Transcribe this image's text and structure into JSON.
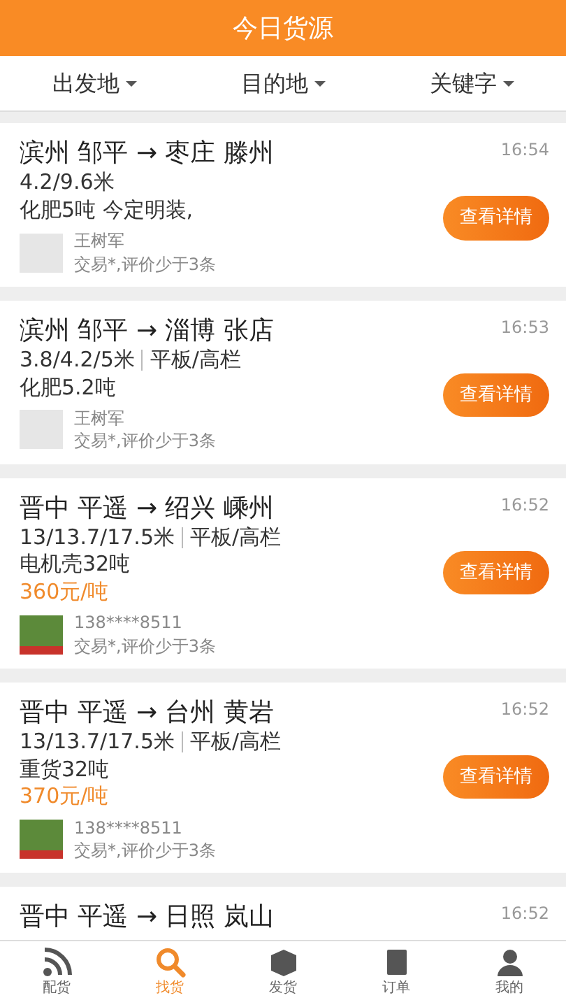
{
  "header": {
    "title": "今日货源"
  },
  "filters": [
    {
      "label": "出发地"
    },
    {
      "label": "目的地"
    },
    {
      "label": "关键字"
    }
  ],
  "listings": [
    {
      "route": "滨州 邹平 → 枣庄 滕州",
      "time": "16:54",
      "length": "4.2/9.6米",
      "cargo": "化肥5吨 今定明装,",
      "button": "查看详情",
      "user": {
        "name": "王树军",
        "rating": "交易*,评价少于3条",
        "kind": "blank"
      }
    },
    {
      "route": "滨州 邹平 → 淄博 张店",
      "time": "16:53",
      "length": "3.8/4.2/5米",
      "body_type": "平板/高栏",
      "cargo": "化肥5.2吨",
      "button": "查看详情",
      "user": {
        "name": "王树军",
        "rating": "交易*,评价少于3条",
        "kind": "blank"
      }
    },
    {
      "route": "晋中 平遥 → 绍兴 嵊州",
      "time": "16:52",
      "length": "13/13.7/17.5米",
      "body_type": "平板/高栏",
      "cargo": "电机壳32吨",
      "price": "360元/吨",
      "button": "查看详情",
      "user": {
        "name": "138****8511",
        "rating": "交易*,评价少于3条",
        "kind": "photo"
      }
    },
    {
      "route": "晋中 平遥 → 台州 黄岩",
      "time": "16:52",
      "length": "13/13.7/17.5米",
      "body_type": "平板/高栏",
      "cargo": "重货32吨",
      "price": "370元/吨",
      "button": "查看详情",
      "user": {
        "name": "138****8511",
        "rating": "交易*,评价少于3条",
        "kind": "photo"
      }
    },
    {
      "route": "晋中 平遥 → 日照 岚山",
      "time": "16:52"
    }
  ],
  "tabs": [
    {
      "label": "配货",
      "selected": false
    },
    {
      "label": "找货",
      "selected": true
    },
    {
      "label": "发货",
      "selected": false
    },
    {
      "label": "订单",
      "selected": false
    },
    {
      "label": "我的",
      "selected": false
    }
  ]
}
